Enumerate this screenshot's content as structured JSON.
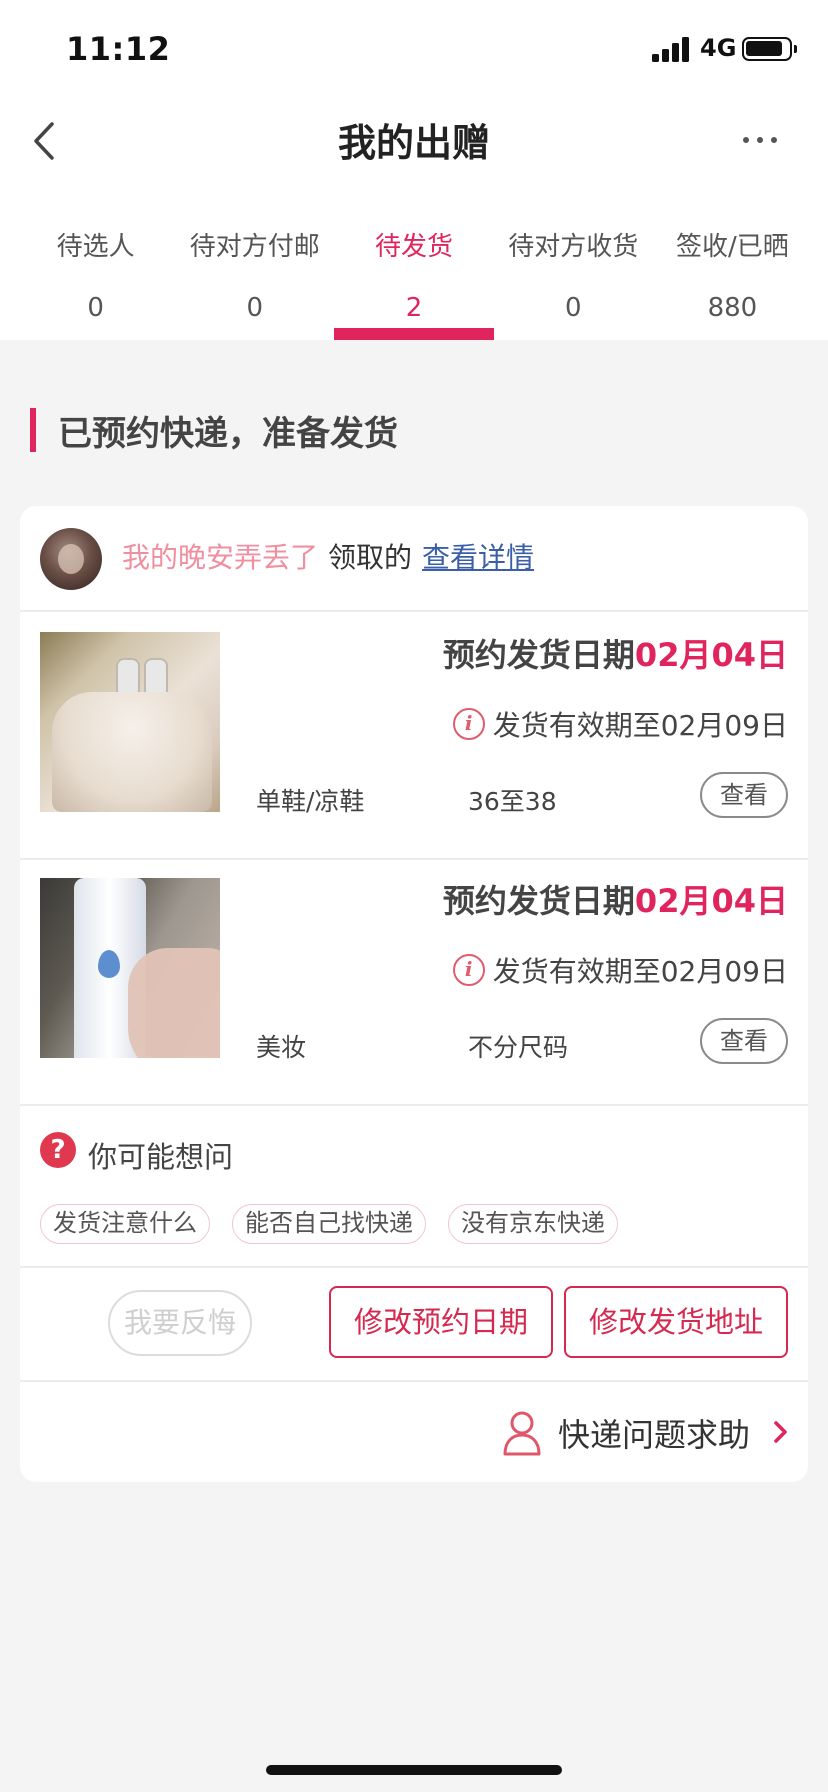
{
  "status_bar": {
    "time": "11:12",
    "network": "4G"
  },
  "nav": {
    "title": "我的出赠"
  },
  "tabs": [
    {
      "label": "待选人",
      "count": "0"
    },
    {
      "label": "待对方付邮",
      "count": "0"
    },
    {
      "label": "待发货",
      "count": "2",
      "active": true
    },
    {
      "label": "待对方收货",
      "count": "0"
    },
    {
      "label": "签收/已晒",
      "count": "880"
    }
  ],
  "section": {
    "title": "已预约快递，准备发货"
  },
  "order": {
    "user_name": "我的晚安弄丢了",
    "user_action": "领取的",
    "detail_link": "查看详情",
    "items": [
      {
        "date_label": "预约发货日期",
        "date_value": "02月04日",
        "valid_text": "发货有效期至02月09日",
        "category": "单鞋/凉鞋",
        "size": "36至38",
        "view_label": "查看"
      },
      {
        "date_label": "预约发货日期",
        "date_value": "02月04日",
        "valid_text": "发货有效期至02月09日",
        "category": "美妆",
        "size": "不分尺码",
        "view_label": "查看"
      }
    ],
    "faq": {
      "title": "你可能想问",
      "chips": [
        "发货注意什么",
        "能否自己找快递",
        "没有京东快递"
      ]
    },
    "actions": {
      "regret": "我要反悔",
      "change_date": "修改预约日期",
      "change_address": "修改发货地址"
    },
    "help": {
      "label": "快递问题求助"
    }
  },
  "colors": {
    "accent": "#e0245e",
    "link": "#3a5fa8",
    "name": "#f08fa0"
  }
}
